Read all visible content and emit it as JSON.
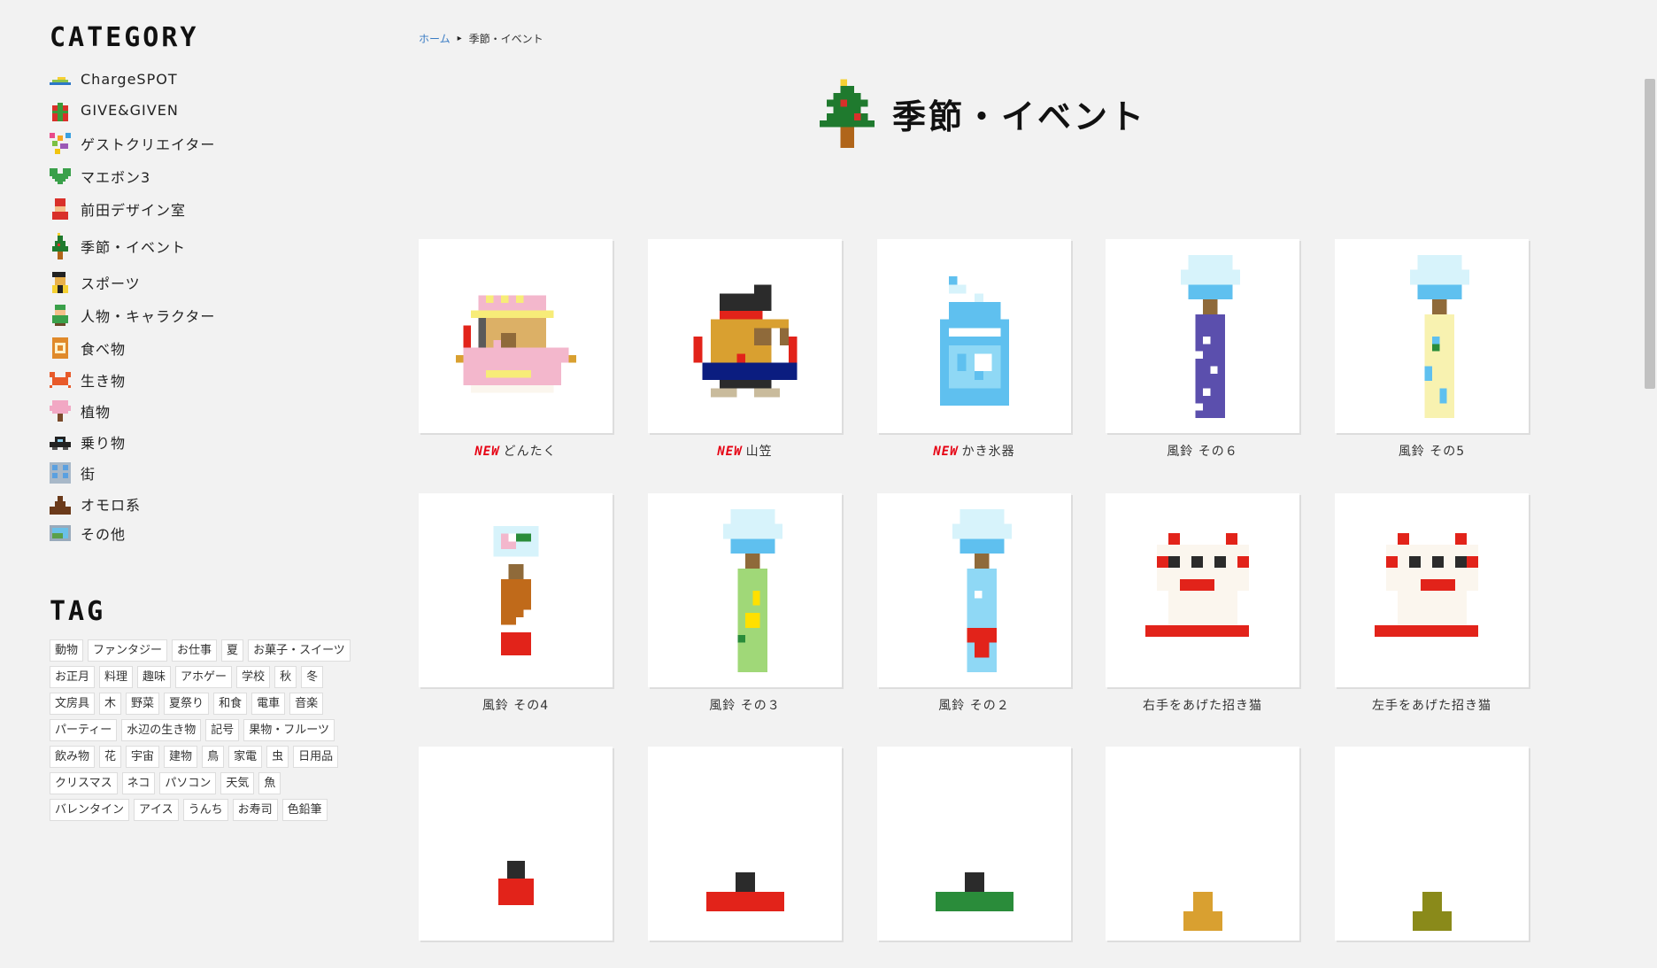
{
  "sidebar": {
    "category_heading": "CATEGORY",
    "categories": [
      {
        "label": "ChargeSPOT",
        "icon": "chargespot-icon"
      },
      {
        "label": "GIVE&GIVEN",
        "icon": "gift-icon"
      },
      {
        "label": "ゲストクリエイター",
        "icon": "guest-creator-icon"
      },
      {
        "label": "マエボン3",
        "icon": "heart-icon"
      },
      {
        "label": "前田デザイン室",
        "icon": "maeda-design-icon"
      },
      {
        "label": "季節・イベント",
        "icon": "christmas-tree-icon"
      },
      {
        "label": "スポーツ",
        "icon": "sports-icon"
      },
      {
        "label": "人物・キャラクター",
        "icon": "person-icon"
      },
      {
        "label": "食べ物",
        "icon": "food-icon"
      },
      {
        "label": "生き物",
        "icon": "crab-icon"
      },
      {
        "label": "植物",
        "icon": "sakura-icon"
      },
      {
        "label": "乗り物",
        "icon": "car-icon"
      },
      {
        "label": "街",
        "icon": "building-icon"
      },
      {
        "label": "オモロ系",
        "icon": "poop-icon"
      },
      {
        "label": "その他",
        "icon": "picture-icon"
      }
    ],
    "tag_heading": "TAG",
    "tags": [
      "動物",
      "ファンタジー",
      "お仕事",
      "夏",
      "お菓子・スイーツ",
      "お正月",
      "料理",
      "趣味",
      "アホゲー",
      "学校",
      "秋",
      "冬",
      "文房具",
      "木",
      "野菜",
      "夏祭り",
      "和食",
      "電車",
      "音楽",
      "パーティー",
      "水辺の生き物",
      "記号",
      "果物・フルーツ",
      "飲み物",
      "花",
      "宇宙",
      "建物",
      "鳥",
      "家電",
      "虫",
      "日用品",
      "クリスマス",
      "ネコ",
      "パソコン",
      "天気",
      "魚",
      "バレンタイン",
      "アイス",
      "うんち",
      "お寿司",
      "色鉛筆"
    ]
  },
  "breadcrumb": {
    "home": "ホーム",
    "current": "季節・イベント"
  },
  "page_title": "季節・イベント",
  "new_badge": "NEW",
  "items": [
    {
      "label": "どんたく",
      "is_new": true,
      "icon": "dontaku-icon"
    },
    {
      "label": "山笠",
      "is_new": true,
      "icon": "yamakasa-icon"
    },
    {
      "label": "かき氷器",
      "is_new": true,
      "icon": "shaved-ice-machine-icon"
    },
    {
      "label": "風鈴 その６",
      "is_new": false,
      "icon": "wind-chime-6-icon"
    },
    {
      "label": "風鈴 その5",
      "is_new": false,
      "icon": "wind-chime-5-icon"
    },
    {
      "label": "風鈴 その4",
      "is_new": false,
      "icon": "wind-chime-4-icon"
    },
    {
      "label": "風鈴 その３",
      "is_new": false,
      "icon": "wind-chime-3-icon"
    },
    {
      "label": "風鈴 その２",
      "is_new": false,
      "icon": "wind-chime-2-icon"
    },
    {
      "label": "右手をあげた招き猫",
      "is_new": false,
      "icon": "maneki-neko-right-icon"
    },
    {
      "label": "左手をあげた招き猫",
      "is_new": false,
      "icon": "maneki-neko-left-icon"
    },
    {
      "label": "",
      "is_new": false,
      "icon": "kadomatsu-icon"
    },
    {
      "label": "",
      "is_new": false,
      "icon": "kagami-mochi-icon"
    },
    {
      "label": "",
      "is_new": false,
      "icon": "green-hat-icon"
    },
    {
      "label": "",
      "is_new": false,
      "icon": "orange-item-icon"
    },
    {
      "label": "",
      "is_new": false,
      "icon": "olive-item-icon"
    }
  ]
}
